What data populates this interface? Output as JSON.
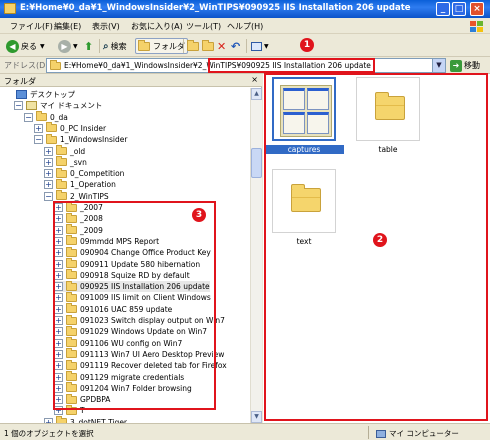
{
  "window": {
    "title": "E:¥Home¥0_da¥1_WindowsInsider¥2_WinTIPS¥090925 IIS Installation 206 update",
    "min_label": "_",
    "max_label": "□",
    "close_label": "×"
  },
  "menu": [
    "ファイル(F)",
    "編集(E)",
    "表示(V)",
    "お気に入り(A)",
    "ツール(T)",
    "ヘルプ(H)"
  ],
  "toolbar": {
    "back_label": "戻る",
    "search_label": "検索",
    "folders_label": "フォルダ"
  },
  "address": {
    "label": "アドレス(D)",
    "value": "E:¥Home¥0_da¥1_WindowsInsider¥2_WinTIPS¥090925 IIS Installation 206 update",
    "go_label": "移動"
  },
  "markers": {
    "m1": "1",
    "m2": "2",
    "m3": "3"
  },
  "folder_pane": {
    "title": "フォルダ",
    "close_label": "×",
    "tree": [
      {
        "label": "デスクトップ",
        "depth": 0,
        "toggle": "",
        "icon": "desktop"
      },
      {
        "label": "マイ ドキュメント",
        "depth": 1,
        "toggle": "−",
        "icon": "docs"
      },
      {
        "label": "0_da",
        "depth": 2,
        "toggle": "−",
        "icon": "folder"
      },
      {
        "label": "0_PC Insider",
        "depth": 3,
        "toggle": "+",
        "icon": "folder"
      },
      {
        "label": "1_WindowsInsider",
        "depth": 3,
        "toggle": "−",
        "icon": "folder"
      },
      {
        "label": "_old",
        "depth": 4,
        "toggle": "+",
        "icon": "folder"
      },
      {
        "label": "_svn",
        "depth": 4,
        "toggle": "+",
        "icon": "folder"
      },
      {
        "label": "0_Competition",
        "depth": 4,
        "toggle": "+",
        "icon": "folder"
      },
      {
        "label": "1_Operation",
        "depth": 4,
        "toggle": "+",
        "icon": "folder"
      },
      {
        "label": "2_WinTIPS",
        "depth": 4,
        "toggle": "−",
        "icon": "folder"
      },
      {
        "label": "_2007",
        "depth": 5,
        "toggle": "+",
        "icon": "folder"
      },
      {
        "label": "_2008",
        "depth": 5,
        "toggle": "+",
        "icon": "folder"
      },
      {
        "label": "_2009",
        "depth": 5,
        "toggle": "+",
        "icon": "folder"
      },
      {
        "label": "09mmdd MPS Report",
        "depth": 5,
        "toggle": "+",
        "icon": "folder"
      },
      {
        "label": "090904 Change Office Product Key",
        "depth": 5,
        "toggle": "+",
        "icon": "folder"
      },
      {
        "label": "090911 Update 580 hibernation",
        "depth": 5,
        "toggle": "+",
        "icon": "folder"
      },
      {
        "label": "090918 Squize RD by default",
        "depth": 5,
        "toggle": "+",
        "icon": "folder"
      },
      {
        "label": "090925 IIS Installation 206 update",
        "depth": 5,
        "toggle": "+",
        "icon": "folder",
        "selected": true
      },
      {
        "label": "091009 IIS limit on Client Windows",
        "depth": 5,
        "toggle": "+",
        "icon": "folder"
      },
      {
        "label": "091016 UAC 859 update",
        "depth": 5,
        "toggle": "+",
        "icon": "folder"
      },
      {
        "label": "091023 Switch display output on Win7",
        "depth": 5,
        "toggle": "+",
        "icon": "folder"
      },
      {
        "label": "091029 Windows Update on Win7",
        "depth": 5,
        "toggle": "+",
        "icon": "folder"
      },
      {
        "label": "091106 WU config on Win7",
        "depth": 5,
        "toggle": "+",
        "icon": "folder"
      },
      {
        "label": "091113 Win7 UI Aero Desktop Preview",
        "depth": 5,
        "toggle": "+",
        "icon": "folder"
      },
      {
        "label": "091119 Recover deleted tab for Firefox",
        "depth": 5,
        "toggle": "+",
        "icon": "folder"
      },
      {
        "label": "091129 migrate credentials",
        "depth": 5,
        "toggle": "+",
        "icon": "folder"
      },
      {
        "label": "091204 Win7 Folder browsing",
        "depth": 5,
        "toggle": "+",
        "icon": "folder"
      },
      {
        "label": "GPDBPA",
        "depth": 5,
        "toggle": "+",
        "icon": "folder"
      },
      {
        "label": "T",
        "depth": 5,
        "toggle": "+",
        "icon": "folder"
      },
      {
        "label": "3_dotNET Tiger",
        "depth": 4,
        "toggle": "+",
        "icon": "folder"
      }
    ]
  },
  "content": {
    "items": [
      {
        "label": "captures",
        "kind": "thumbnail",
        "selected": true
      },
      {
        "label": "table",
        "kind": "folder"
      },
      {
        "label": "text",
        "kind": "folder"
      }
    ]
  },
  "status": {
    "left": "1 個のオブジェクトを選択",
    "right": "マイ コンピューター"
  },
  "colors": {
    "highlight": "#e0141c",
    "selection": "#316ac5",
    "titlebar": "#0a5fd8"
  }
}
